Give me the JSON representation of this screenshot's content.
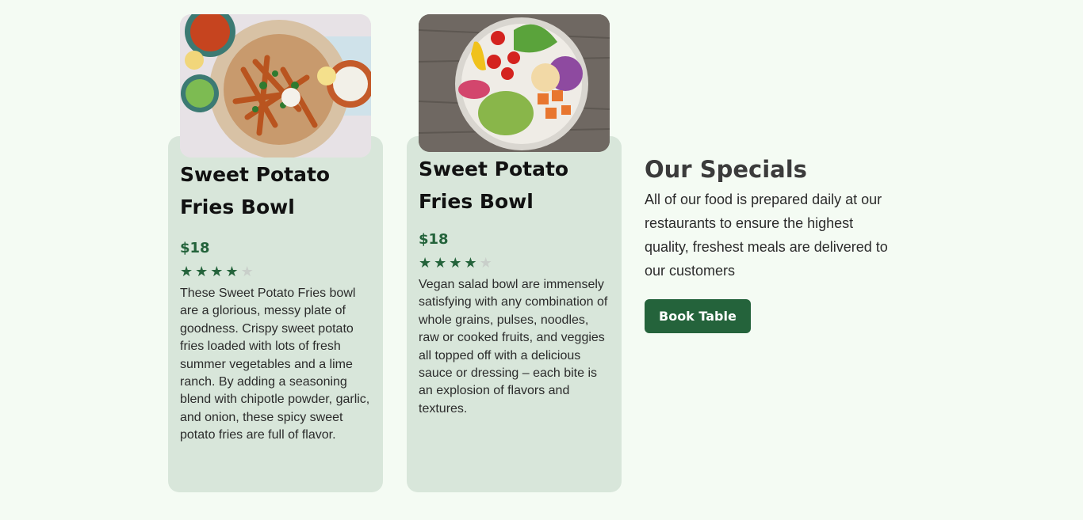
{
  "cards": [
    {
      "image_alt": "sweet potato fries bowl photo",
      "title": "Sweet Potato Fries Bowl",
      "price": "$18",
      "rating": 4,
      "rating_max": 5,
      "description": "These Sweet Potato Fries bowl are a glorious, messy plate of goodness. Crispy sweet potato fries loaded with lots of fresh summer vegetables and a lime ranch. By adding a seasoning blend with chipotle powder, garlic, and onion, these spicy sweet potato fries are full of flavor."
    },
    {
      "image_alt": "vegan salad bowl photo",
      "title": "Sweet Potato Fries Bowl",
      "price": "$18",
      "rating": 4,
      "rating_max": 5,
      "description": "Vegan salad bowl are immensely satisfying with any combination of whole grains, pulses, noodles, raw or cooked fruits, and veggies all topped off with a delicious sauce or dressing – each bite is an explosion of flavors and textures."
    }
  ],
  "specials": {
    "title": "Our Specials",
    "text": "All of our food is prepared daily at our restaurants to ensure the highest quality, freshest meals are delivered to our customers",
    "button_label": "Book Table"
  },
  "colors": {
    "background": "#f4fbf3",
    "card": "#d8e6da",
    "accent": "#24633b",
    "star_off": "#c9cfca"
  }
}
